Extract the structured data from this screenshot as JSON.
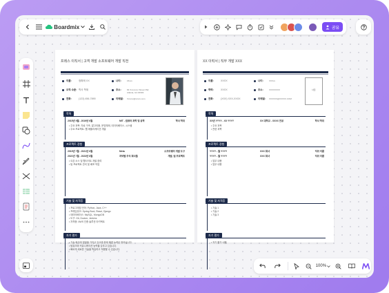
{
  "app": {
    "name": "Boardmix",
    "share_label": "공유"
  },
  "toolbar_right": {
    "users": [
      "A",
      "B",
      "C"
    ],
    "zoom": "100%"
  },
  "resume_left": {
    "title": "프레스 이직서 | 고객 개발 소프트웨어 개발 직전",
    "info": [
      {
        "label": "이름:",
        "value": "정확희 XX",
        "label2": "나이:",
        "value2": "15xxx"
      },
      {
        "label": "오직 수준:",
        "value": "학사 학위",
        "label2": "주소:",
        "value2": "84 Xxxxxxxx Street NW, Atlanta, GA 30303"
      },
      {
        "label": "전화:",
        "value": "(123) 456-7890",
        "label2": "이메일:",
        "value2": "Xxxxxx@xxxxx.com"
      }
    ],
    "sections": [
      {
        "title": "학력",
        "rows": [
          {
            "date": "2015년 9월 - 2019년 6월",
            "org": "MIT - 컴퓨터 과학 및 공학",
            "role": "학사 학위"
          }
        ],
        "items": [
          "주요 과목: 자료 구조, 알고리즘, 운영체제, 데이터베이스, 시스템",
          "주요 프로젝트: 웹 애플리케이션 개발"
        ]
      },
      {
        "title": "프로젝트 경험",
        "rows": [
          {
            "date": "2019년 7월 - 2021년 6월",
            "org": "Meta",
            "role": "소프트웨어 개발 도구"
          },
          {
            "date": "2021년 7월 - 2023년 8월",
            "org": "저녁별 주식 회사들",
            "role": "개발, 팀 프로젝트"
          }
        ],
        "items": [
          "오픈 소스 및 웹사이트 개발 참여",
          "팀 프로젝트 관리 및 배포 작업"
        ]
      },
      {
        "title": "기술 및 자격증",
        "items": [
          "프로그래밍 언어: Python, Java, C++",
          "프레임워크: Spring Boot, React, Django",
          "데이터베이스: MySQL, MongoDB",
          "도구: Git, Docker, Jenkins",
          "자격증: AWS 인증 솔루션 아키텍트"
        ]
      },
      {
        "title": "자기 평가",
        "items": [
          "기술 혁신에 열정을 가지고 있으며 문제 해결 능력이 뛰어납니다.",
          "팀워크와 커뮤니케이션 능력을 갖추고 있습니다.",
          "빠르게 새로운 기술을 학습하고 적용할 수 있습니다."
        ]
      }
    ]
  },
  "resume_right": {
    "title": "XX 이력서 | 직무 개발 XXX",
    "info": [
      {
        "label": "이름:",
        "value": "XXXX",
        "label2": "나이:",
        "value2": "XXXxx"
      },
      {
        "label": "학력:",
        "value": "XXXX",
        "label2": "주소:",
        "value2": "XXXXXXXX"
      },
      {
        "label": "전화:",
        "value": "(XXX) XXX-XXXX",
        "label2": "이메일:",
        "value2": "XXXXXX@XXXXX.COM"
      }
    ],
    "photo_label": "사진",
    "sections": [
      {
        "title": "학력",
        "rows": [
          {
            "date": "XX년 YYYY - XX YYYY",
            "org": "XX 대학교 - XXXX 전공",
            "role": "학사 학위"
          }
        ],
        "items": [
          "주요 과목",
          "관련 과목"
        ]
      },
      {
        "title": "프로젝트 경험",
        "rows": [
          {
            "date": "YYYY - 월 YYYY",
            "org": "XXX 회사",
            "role": "직위 이름"
          },
          {
            "date": "YYYY - 월 YYYY",
            "org": "XXX 회사",
            "role": "직위 이름"
          }
        ],
        "items": [
          "업무 내용",
          "업무 내용"
        ]
      },
      {
        "title": "기술 및 자격증",
        "items": [
          "기술 1",
          "기술 2",
          "기술 3"
        ]
      },
      {
        "title": "자기 평가",
        "items": [
          "자기 평가 내용"
        ]
      }
    ]
  }
}
